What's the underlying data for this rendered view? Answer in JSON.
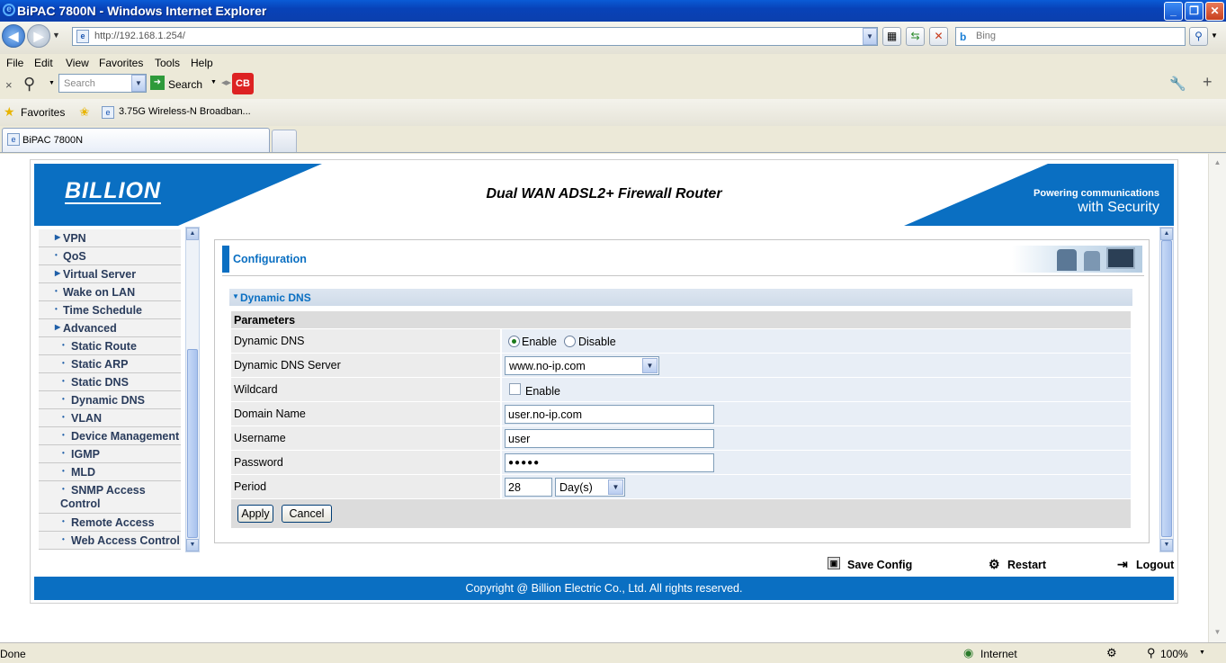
{
  "window": {
    "title": "BiPAC 7800N - Windows Internet Explorer",
    "minimize": "_",
    "maximize": "❐",
    "close": "✕"
  },
  "address_bar": {
    "url": "http://192.168.1.254/",
    "search_placeholder": "Bing"
  },
  "menu": [
    "File",
    "Edit",
    "View",
    "Favorites",
    "Tools",
    "Help"
  ],
  "toolbar": {
    "search_placeholder": "Search",
    "search_button": "Search",
    "cb_label": "CB"
  },
  "favorites_bar": {
    "favorites_label": "Favorites",
    "link1": "3.75G Wireless-N Broadban..."
  },
  "tabs": [
    {
      "label": "BiPAC 7800N"
    }
  ],
  "banner": {
    "logo": "BILLION",
    "product": "Dual WAN ADSL2+ Firewall Router",
    "tagline_top": "Powering communications",
    "tagline_bottom": "with Security"
  },
  "nav": {
    "items": [
      {
        "label": "VPN",
        "expandable": true
      },
      {
        "label": "QoS",
        "expandable": false
      },
      {
        "label": "Virtual Server",
        "expandable": true
      },
      {
        "label": "Wake on LAN",
        "expandable": false
      },
      {
        "label": "Time Schedule",
        "expandable": false
      },
      {
        "label": "Advanced",
        "expandable": true
      },
      {
        "label": "Static Route",
        "sub": true
      },
      {
        "label": "Static ARP",
        "sub": true
      },
      {
        "label": "Static DNS",
        "sub": true
      },
      {
        "label": "Dynamic DNS",
        "sub": true
      },
      {
        "label": "VLAN",
        "sub": true
      },
      {
        "label": "Device Management",
        "sub": true
      },
      {
        "label": "IGMP",
        "sub": true
      },
      {
        "label": "MLD",
        "sub": true
      },
      {
        "label": "SNMP Access",
        "label2": "Control",
        "sub": true
      },
      {
        "label": "Remote Access",
        "sub": true
      },
      {
        "label": "Web Access Control",
        "sub": true
      }
    ]
  },
  "config": {
    "title": "Configuration",
    "section": "Dynamic DNS",
    "params_label": "Parameters",
    "rows": {
      "dynamic_dns": {
        "label": "Dynamic DNS",
        "enable": "Enable",
        "disable": "Disable",
        "selected": "Enable"
      },
      "server": {
        "label": "Dynamic DNS Server",
        "value": "www.no-ip.com"
      },
      "wildcard": {
        "label": "Wildcard",
        "enable": "Enable",
        "checked": false
      },
      "domain": {
        "label": "Domain Name",
        "value": "user.no-ip.com"
      },
      "username": {
        "label": "Username",
        "value": "user"
      },
      "password": {
        "label": "Password",
        "value": "●●●●●"
      },
      "period": {
        "label": "Period",
        "value": "28",
        "unit": "Day(s)"
      }
    },
    "apply": "Apply",
    "cancel": "Cancel"
  },
  "footer": {
    "save_config": "Save Config",
    "restart": "Restart",
    "logout": "Logout",
    "copyright": "Copyright @ Billion Electric Co., Ltd. All rights reserved."
  },
  "statusbar": {
    "left": "Done",
    "zone": "Internet",
    "zoom": "100%"
  }
}
